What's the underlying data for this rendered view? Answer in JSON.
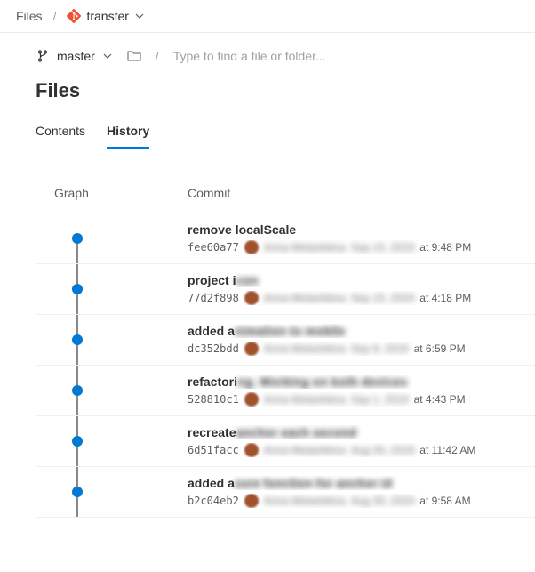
{
  "breadcrumb": {
    "root": "Files",
    "repo": "transfer"
  },
  "branch": {
    "name": "master",
    "filter_placeholder": "Type to find a file or folder..."
  },
  "page_title": "Files",
  "tabs": {
    "contents": "Contents",
    "history": "History"
  },
  "columns": {
    "graph": "Graph",
    "commit": "Commit"
  },
  "commits": [
    {
      "title_visible": "remove localScale",
      "title_redacted": "",
      "hash": "fee60a77",
      "author_redacted": "Anna Melashkina",
      "date_redacted": "Sep 10, 2019",
      "time": "at 9:48 PM"
    },
    {
      "title_visible": "project i",
      "title_redacted": "con",
      "hash": "77d2f898",
      "author_redacted": "Anna Melashkina",
      "date_redacted": "Sep 10, 2019",
      "time": "at 4:18 PM"
    },
    {
      "title_visible": "added a",
      "title_redacted": "nimation to mobile",
      "hash": "dc352bdd",
      "author_redacted": "Anna Melashkina",
      "date_redacted": "Sep 9, 2019",
      "time": "at 6:59 PM"
    },
    {
      "title_visible": "refactori",
      "title_redacted": "ng. Working on both devices",
      "hash": "528810c1",
      "author_redacted": "Anna Melashkina",
      "date_redacted": "Sep 1, 2019",
      "time": "at 4:43 PM"
    },
    {
      "title_visible": "recreate",
      "title_redacted": "anchor each second",
      "hash": "6d51facc",
      "author_redacted": "Anna Melashkina",
      "date_redacted": "Aug 30, 2019",
      "time": "at 11:42 AM"
    },
    {
      "title_visible": "added a",
      "title_redacted": "zure function for anchor id",
      "hash": "b2c04eb2",
      "author_redacted": "Anna Melashkina",
      "date_redacted": "Aug 30, 2019",
      "time": "at 9:58 AM"
    }
  ]
}
